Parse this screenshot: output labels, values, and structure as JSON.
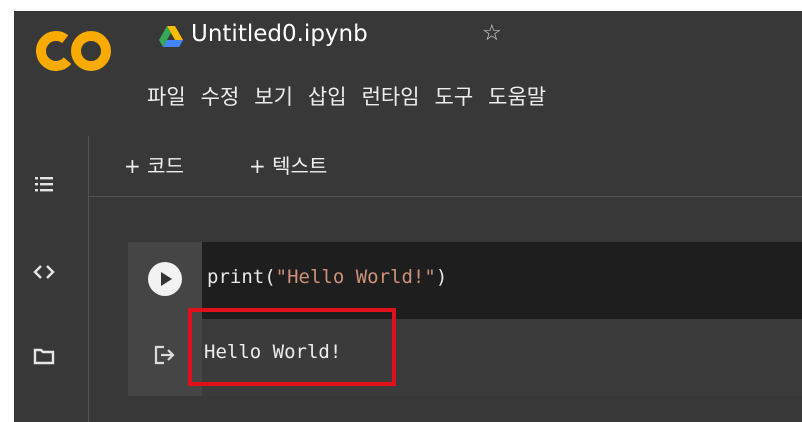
{
  "header": {
    "logo_text": "CO",
    "title": "Untitled0.ipynb",
    "star_glyph": "☆",
    "menu": [
      "파일",
      "수정",
      "보기",
      "삽입",
      "런타임",
      "도구",
      "도움말"
    ]
  },
  "toolbar": {
    "add_code": "+ 코드",
    "add_text": "+ 텍스트"
  },
  "left_rail": {
    "icons": [
      "table-of-contents-icon",
      "code-snippets-icon",
      "files-icon"
    ]
  },
  "cell": {
    "code": {
      "fn": "print",
      "open": "(",
      "string": "\"Hello World!\"",
      "close": ")"
    },
    "output": "Hello World!"
  },
  "colors": {
    "app_bg": "#383838",
    "code_bg": "#1e1e1e",
    "code_fn": "#e8e8e8",
    "code_string": "#ce9178",
    "highlight": "#e0101a",
    "logo_orange": "#f9ab00"
  }
}
